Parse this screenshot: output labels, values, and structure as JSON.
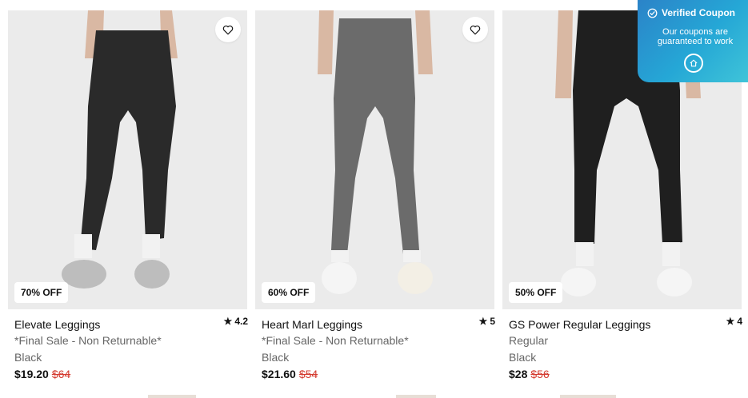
{
  "products": [
    {
      "discount": "70% OFF",
      "rating": "4.2",
      "name": "Elevate Leggings",
      "note": "*Final Sale - Non Returnable*",
      "color": "Black",
      "price": "$19.20",
      "original_price": "$64",
      "legging_color": "#2a2a2a"
    },
    {
      "discount": "60% OFF",
      "rating": "5",
      "name": "Heart Marl Leggings",
      "note": "*Final Sale - Non Returnable*",
      "color": "Black",
      "price": "$21.60",
      "original_price": "$54",
      "legging_color": "#6b6b6b"
    },
    {
      "discount": "50% OFF",
      "rating": "4",
      "name": "GS Power Regular Leggings",
      "note": "Regular",
      "color": "Black",
      "price": "$28",
      "original_price": "$56",
      "legging_color": "#1f1f1f"
    }
  ],
  "coupon": {
    "title": "Verified Coupon",
    "message": "Our coupons are guaranteed to work"
  },
  "icons": {
    "wishlist": "heart-outline-icon",
    "rating": "star-icon",
    "verified": "check-circle-icon",
    "home": "home-icon"
  },
  "colors": {
    "sale_price": "#d43a2f",
    "coupon_gradient_start": "#2b83c8",
    "coupon_gradient_end": "#3fc4d8"
  }
}
